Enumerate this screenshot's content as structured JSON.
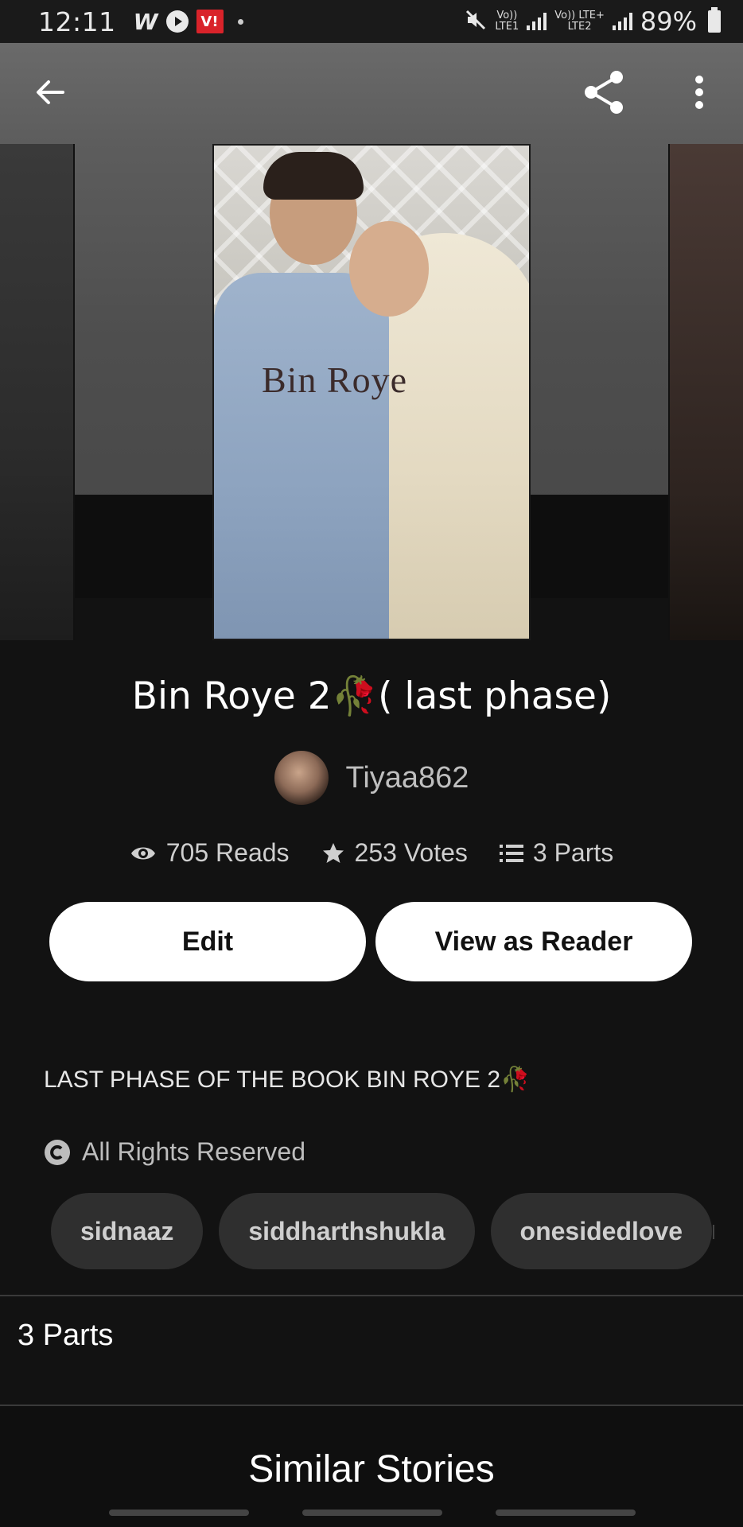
{
  "status_bar": {
    "time": "12:11",
    "w_label": "W",
    "vi_label": "V!",
    "lte1_top": "Vo))",
    "lte1_bottom": "LTE1",
    "lte2_top": "Vo)) LTE+",
    "lte2_bottom": "LTE2",
    "battery": "89%"
  },
  "header": {
    "back_icon": "arrow-left-icon",
    "share_icon": "share-icon",
    "more_icon": "more-vert-icon"
  },
  "cover": {
    "title_text": "Bin Roye"
  },
  "story": {
    "title": "Bin Roye 2🥀( last phase)",
    "author": "Tiyaa862",
    "reads": "705 Reads",
    "votes": "253 Votes",
    "parts": "3 Parts",
    "description": "LAST PHASE OF THE BOOK BIN ROYE 2🥀",
    "rights": "All Rights Reserved"
  },
  "actions": {
    "edit_label": "Edit",
    "reader_label": "View as Reader"
  },
  "tags": [
    "sidnaaz",
    "siddharthshukla",
    "onesidedlove"
  ],
  "sections": {
    "parts_heading": "3 Parts",
    "similar_heading": "Similar Stories"
  },
  "colors": {
    "background": "#121212",
    "button_bg": "#ffffff",
    "tag_bg": "#2f2f2f"
  }
}
